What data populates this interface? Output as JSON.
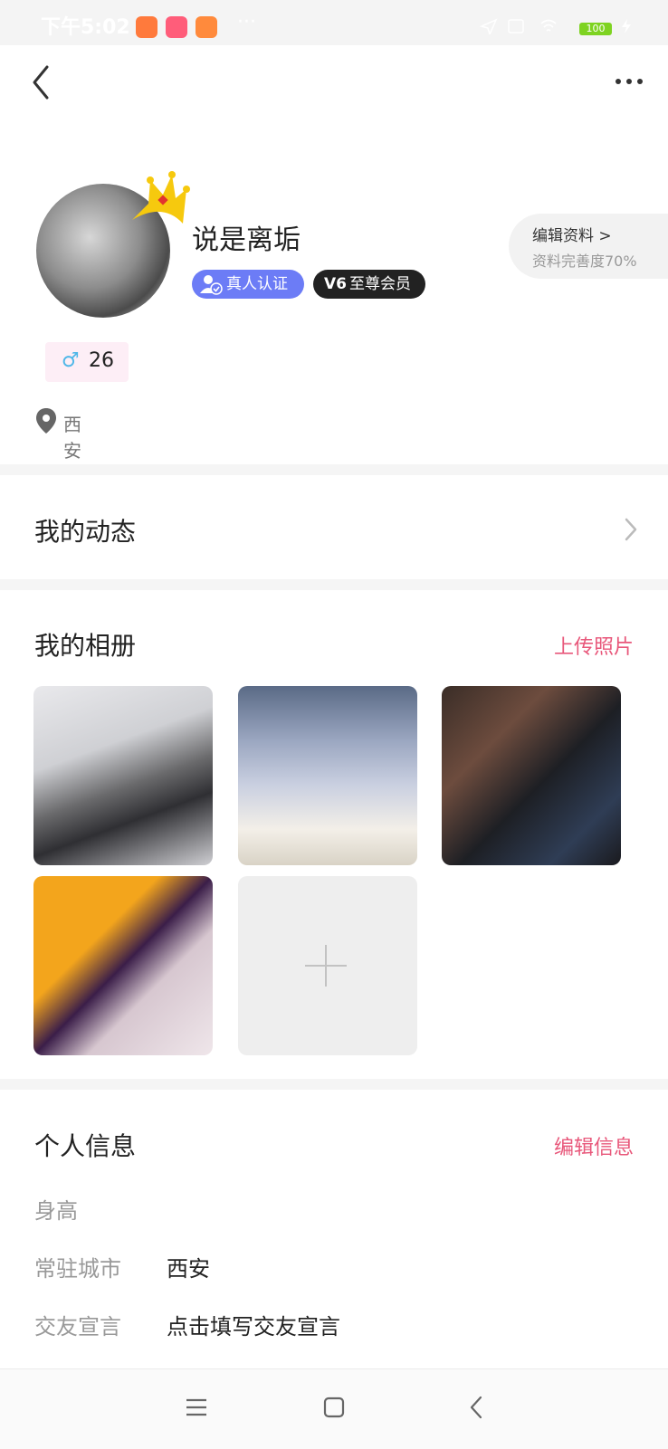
{
  "status_bar": {
    "time": "下午5:02",
    "more": "···",
    "battery": "100"
  },
  "header": {
    "back_icon": "chevron-left-icon",
    "more_icon": "more-horizontal-icon"
  },
  "profile": {
    "name": "说是离垢",
    "badge_real": "真人认证",
    "badge_vip_level": "V6",
    "badge_vip": "至尊会员",
    "edit_profile": "编辑资料 >",
    "profile_completion": "资料完善度70%",
    "gender_symbol": "♂",
    "age": "26",
    "location": "西安"
  },
  "sections": {
    "my_moments": "我的动态",
    "my_album": "我的相册",
    "upload_photos": "上传照片",
    "personal_info": "个人信息",
    "edit_info": "编辑信息"
  },
  "album": {
    "photos": [
      "photo-1",
      "photo-2",
      "photo-3",
      "photo-4"
    ],
    "add_icon": "plus-icon"
  },
  "personal_info": {
    "rows": [
      {
        "label": "身高",
        "value": ""
      },
      {
        "label": "常驻城市",
        "value": "西安"
      },
      {
        "label": "交友宣言",
        "value": "点击填写交友宣言"
      }
    ]
  },
  "colors": {
    "accent": "#e8577a",
    "badge_real": "#6c7cf6",
    "badge_vip": "#222222",
    "crown": "#f6c90e",
    "gender_bg": "#fdeef6"
  }
}
